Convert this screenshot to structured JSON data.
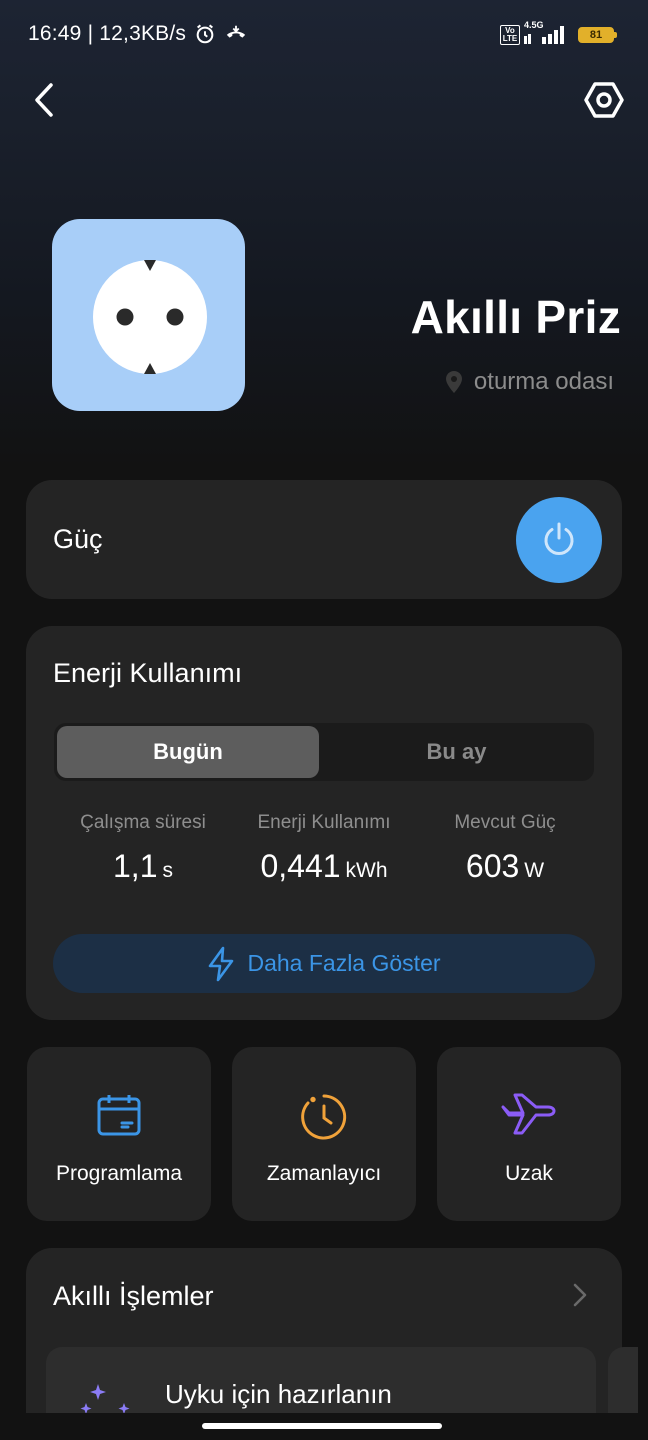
{
  "status_bar": {
    "time_speed": "16:49 | 12,3KB/s",
    "network_label": "4.5G",
    "volte_label": "Vo LTE",
    "battery_level": "81",
    "icons": [
      "alarm-icon",
      "call-icon",
      "volte-icon",
      "signal-icon",
      "battery-icon"
    ]
  },
  "header": {
    "icons": [
      "back-arrow-icon",
      "settings-hex-icon"
    ]
  },
  "device": {
    "title": "Akıllı Priz",
    "location": "oturma odası",
    "tile_color": "#a8cef8"
  },
  "power": {
    "label": "Güç",
    "button_color": "#4aa3ef"
  },
  "energy": {
    "title": "Enerji Kullanımı",
    "tabs": [
      {
        "label": "Bugün",
        "active": true
      },
      {
        "label": "Bu ay",
        "active": false
      }
    ],
    "stats": [
      {
        "label": "Çalışma süresi",
        "value": "1,1",
        "unit": "s"
      },
      {
        "label": "Enerji Kullanımı",
        "value": "0,441",
        "unit": "kWh"
      },
      {
        "label": "Mevcut Güç",
        "value": "603",
        "unit": "W"
      }
    ],
    "more_button": "Daha Fazla Göster"
  },
  "features": [
    {
      "label": "Programlama",
      "icon": "calendar-icon",
      "color": "#3b95e6"
    },
    {
      "label": "Zamanlayıcı",
      "icon": "clock-icon",
      "color": "#f0a23a"
    },
    {
      "label": "Uzak",
      "icon": "airplane-icon",
      "color": "#8b5cf6"
    }
  ],
  "smart_actions": {
    "title": "Akıllı İşlemler",
    "items": [
      {
        "label": "Uyku için hazırlanın",
        "icon": "sparkles-icon"
      }
    ]
  },
  "colors": {
    "accent_blue": "#3b95e6",
    "background": "#121212",
    "card": "#242424"
  }
}
